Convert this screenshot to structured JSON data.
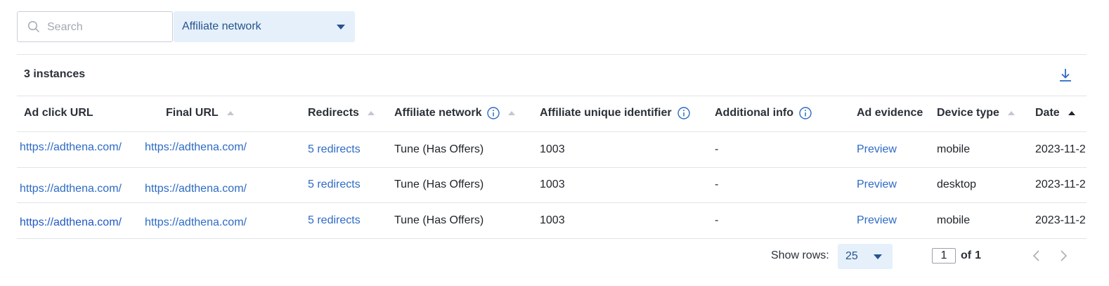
{
  "toolbar": {
    "search_placeholder": "Search",
    "filter_label": "Affiliate network"
  },
  "summary": {
    "instances_label": "3 instances"
  },
  "table": {
    "headers": {
      "ad_click_url": "Ad click URL",
      "final_url": "Final URL",
      "redirects": "Redirects",
      "affiliate_network": "Affiliate network",
      "affiliate_uid": "Affiliate unique identifier",
      "additional_info": "Additional info",
      "ad_evidence": "Ad evidence",
      "device_type": "Device type",
      "date": "Date"
    },
    "rows": [
      {
        "ad_click_url": "https://adthena.com/",
        "final_url": "https://adthena.com/",
        "redirects": "5 redirects",
        "affiliate_network": "Tune (Has Offers)",
        "affiliate_uid": "1003",
        "additional_info": "-",
        "ad_evidence": "Preview",
        "device_type": "mobile",
        "date": "2023-11-2"
      },
      {
        "ad_click_url": "https://adthena.com/",
        "final_url": "https://adthena.com/",
        "redirects": "5 redirects",
        "affiliate_network": "Tune (Has Offers)",
        "affiliate_uid": "1003",
        "additional_info": "-",
        "ad_evidence": "Preview",
        "device_type": "desktop",
        "date": "2023-11-2"
      },
      {
        "ad_click_url": "https://adthena.com/",
        "final_url": "https://adthena.com/",
        "redirects": "5 redirects",
        "affiliate_network": "Tune (Has Offers)",
        "affiliate_uid": "1003",
        "additional_info": "-",
        "ad_evidence": "Preview",
        "device_type": "mobile",
        "date": "2023-11-2"
      }
    ]
  },
  "pagination": {
    "show_rows_label": "Show rows:",
    "rows_per_page": "25",
    "current_page": "1",
    "of_label": "of",
    "total_pages": "1"
  },
  "colors": {
    "link": "#2d6bc4",
    "accent_bg": "#e6f0fb",
    "accent_text": "#26548c"
  },
  "icons": [
    "search-icon",
    "chevron-down-icon",
    "download-icon",
    "info-icon",
    "sort-arrow-icon",
    "chevron-left-icon",
    "chevron-right-icon"
  ]
}
